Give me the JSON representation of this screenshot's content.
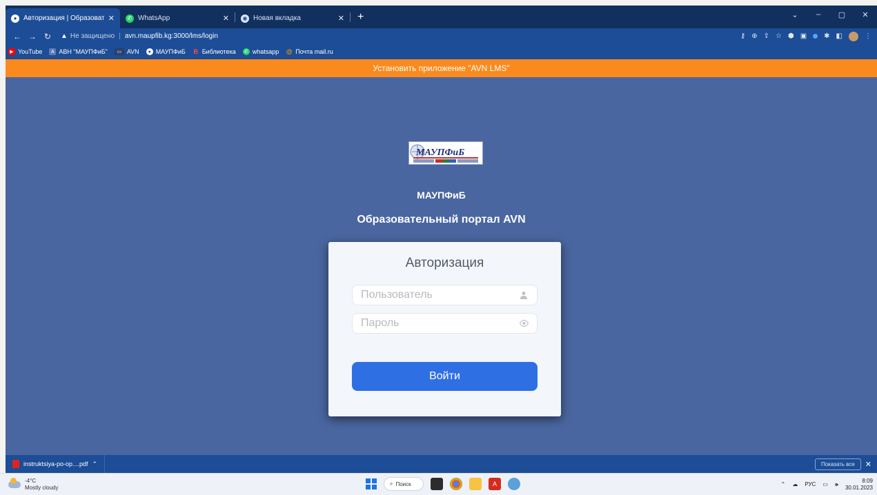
{
  "browser": {
    "tabs": [
      {
        "title": "Авторизация | Образовательны",
        "active": true,
        "icon": "globe-icon"
      },
      {
        "title": "WhatsApp",
        "active": false,
        "icon": "whatsapp-icon"
      },
      {
        "title": "Новая вкладка",
        "active": false,
        "icon": "chrome-icon"
      }
    ],
    "new_tab": "+",
    "window_controls": {
      "dropdown": "⌄",
      "minimize": "–",
      "maximize": "▢",
      "close": "✕"
    },
    "address": {
      "insecure_label": "Не защищено",
      "url": "avn.maupfib.kg:3000/lms/login"
    },
    "bookmarks": [
      {
        "label": "YouTube",
        "icon": "youtube-icon",
        "color": "#ff0000"
      },
      {
        "label": "АВН \"МАУПФиБ\"",
        "icon": "avn-icon",
        "color": "#5c7bb5"
      },
      {
        "label": "AVN",
        "icon": "avn-icon",
        "color": "#2b3f6b"
      },
      {
        "label": "МАУПФиБ",
        "icon": "globe-icon",
        "color": "#4a4a4a"
      },
      {
        "label": "Библиотека",
        "icon": "b-icon",
        "color": "#d22"
      },
      {
        "label": "whatsapp",
        "icon": "whatsapp-icon",
        "color": "#25d366"
      },
      {
        "label": "Почта mail.ru",
        "icon": "mail-icon",
        "color": "#ff9e00"
      }
    ]
  },
  "page": {
    "install_banner": "Установить приложение \"AVN LMS\"",
    "logo_text": "МАУПФиБ",
    "org_name": "МАУПФиБ",
    "portal_title": "Образовательный портал AVN",
    "login": {
      "title": "Авторизация",
      "username_placeholder": "Пользователь",
      "username_value": "",
      "password_placeholder": "Пароль",
      "password_value": "",
      "submit_label": "Войти"
    }
  },
  "downloads": {
    "item": "instruktsiya-po-op....pdf",
    "show_all": "Показать все"
  },
  "taskbar": {
    "weather_temp": "-4°C",
    "weather_desc": "Mostly cloudy",
    "search_label": "Поиск",
    "language": "РУС",
    "time": "8:09",
    "date": "30.01.2023"
  },
  "colors": {
    "banner": "#fb8a1e",
    "page_bg": "#4a66a0",
    "primary_button": "#2f6fe4",
    "chrome_dark": "#11305e",
    "chrome": "#1c4d96"
  }
}
